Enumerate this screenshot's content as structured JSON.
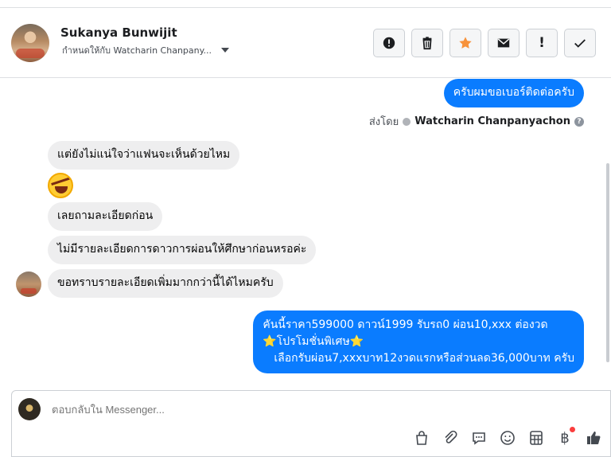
{
  "header": {
    "contact_name": "Sukanya Bunwijit",
    "assigned_to": "กำหนดให้กับ Watcharin Chanpany..."
  },
  "actions": [
    {
      "name": "report-icon"
    },
    {
      "name": "trash-icon"
    },
    {
      "name": "star-icon",
      "color": "#f7923b"
    },
    {
      "name": "envelope-icon"
    },
    {
      "name": "exclamation-icon",
      "label": "!"
    },
    {
      "name": "check-icon"
    }
  ],
  "messages": {
    "out_1": "ครับผมขอเบอร์ติดต่อครับ",
    "sent_by_label": "ส่งโดย",
    "sent_by_name": "Watcharin Chanpanyachon",
    "help_mark": "?",
    "in_1": "แต่ยังไม่แน่ใจว่าแฟนจะเห็นด้วยไหม",
    "emoji": "rolling-on-floor-laughing",
    "in_2": "เลยถามละเอียดก่อน",
    "in_3": "ไม่มีรายละเอียดการดาวการผ่อนให้ศึกษาก่อนหรอค่ะ",
    "in_4": "ขอทราบรายละเอียดเพิ่มมากกว่านี้ได้ไหมครับ",
    "out_2_line1": "คันนี้ราคา599000 ดาวน์1999 รับรถ0 ผ่อน10,xxx ต่องวด",
    "out_2_line2": "⭐โปรโมชั่นพิเศษ⭐",
    "out_2_line3": "เลือกรับผ่อน7,xxxบาท12งวดแรกหรือส่วนลด36,000บาท ครับ"
  },
  "composer": {
    "placeholder": "ตอบกลับใน Messenger...",
    "tools": [
      "bag-icon",
      "paperclip-icon",
      "chat-bubble-icon",
      "smile-icon",
      "calculator-icon",
      "baht-icon",
      "thumbs-up-icon"
    ],
    "baht_symbol": "฿"
  },
  "colors": {
    "outgoing_bubble": "#0a7cff",
    "incoming_bubble": "#eeeeef",
    "star": "#f7923b"
  }
}
